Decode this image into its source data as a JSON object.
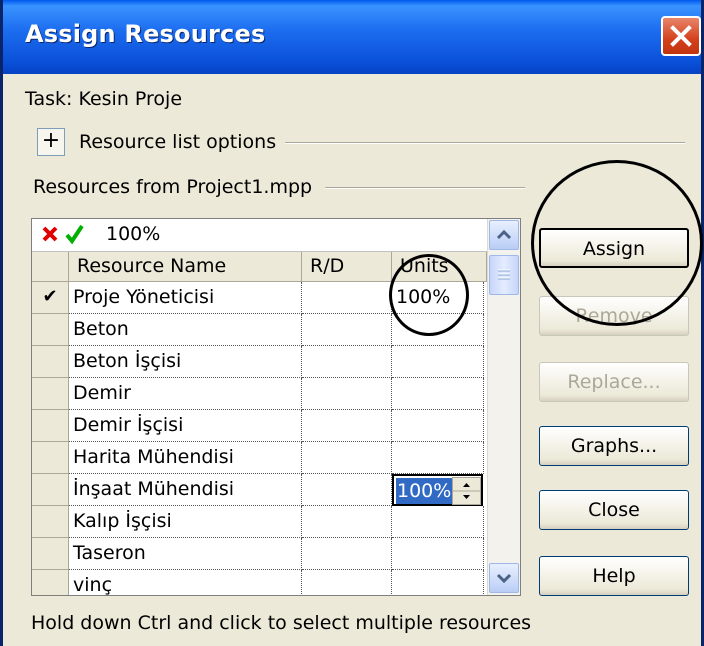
{
  "window": {
    "title": "Assign Resources"
  },
  "task": {
    "label": "Task: Kesin Proje"
  },
  "resource_list_options": {
    "toggle": "+",
    "label": "Resource list options"
  },
  "resources_from": {
    "label": "Resources from Project1.mpp"
  },
  "edit_bar": {
    "value": "100%"
  },
  "table": {
    "headers": {
      "name": "Resource Name",
      "rd": "R/D",
      "units": "Units"
    },
    "rows": [
      {
        "check": "✔",
        "name": "Proje Yöneticisi",
        "rd": "",
        "units": "100%"
      },
      {
        "check": "",
        "name": "Beton",
        "rd": "",
        "units": ""
      },
      {
        "check": "",
        "name": "Beton İşçisi",
        "rd": "",
        "units": ""
      },
      {
        "check": "",
        "name": "Demir",
        "rd": "",
        "units": ""
      },
      {
        "check": "",
        "name": "Demir İşçisi",
        "rd": "",
        "units": ""
      },
      {
        "check": "",
        "name": "Harita Mühendisi",
        "rd": "",
        "units": ""
      },
      {
        "check": "",
        "name": "İnşaat Mühendisi",
        "rd": "",
        "units": "100%"
      },
      {
        "check": "",
        "name": "Kalıp İşçisi",
        "rd": "",
        "units": ""
      },
      {
        "check": "",
        "name": "Taseron",
        "rd": "",
        "units": ""
      },
      {
        "check": "",
        "name": "vinç",
        "rd": "",
        "units": ""
      }
    ]
  },
  "buttons": {
    "assign": "Assign",
    "remove": "Remove",
    "replace": "Replace...",
    "graphs": "Graphs...",
    "close": "Close",
    "help": "Help"
  },
  "footer": {
    "hint": "Hold down Ctrl and click to select multiple resources"
  },
  "colors": {
    "title_bar": "#0a4fd8",
    "dialog_bg": "#ece9d8",
    "selection": "#316ac5",
    "close_red": "#d4401c"
  }
}
